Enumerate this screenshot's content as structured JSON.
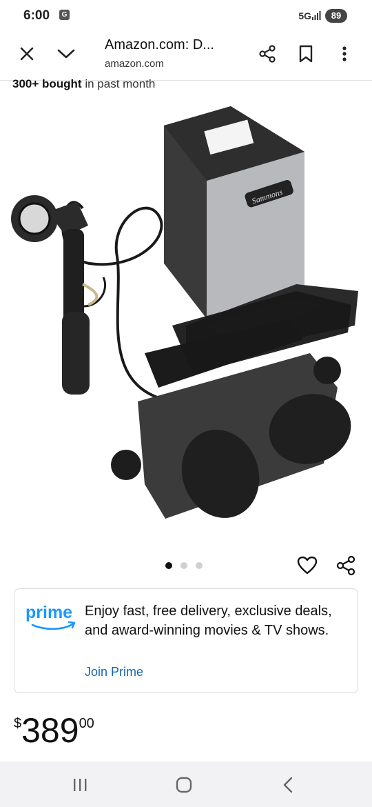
{
  "status_bar": {
    "time": "6:00",
    "app_icon": "G",
    "network": "5G",
    "battery": "89"
  },
  "top_bar": {
    "title": "Amazon.com: D...",
    "url": "amazon.com",
    "icons": [
      "close-icon",
      "chevron-down-icon",
      "share-icon",
      "bookmark-icon",
      "more-vert-icon"
    ]
  },
  "product": {
    "bought_bold": "300+ bought",
    "bought_rest": " in past month",
    "image_carousel": {
      "count": 3,
      "active": 1
    }
  },
  "prime": {
    "logo_text": "prime",
    "message": "Enjoy fast, free delivery, exclusive deals, and award-winning movies & TV shows.",
    "link": "Join Prime",
    "accent_color": "#1a98ff"
  },
  "price": {
    "symbol": "$",
    "whole": "389",
    "fraction": "00"
  },
  "nav": {
    "icons": [
      "recent-apps-icon",
      "home-icon",
      "back-icon"
    ]
  }
}
